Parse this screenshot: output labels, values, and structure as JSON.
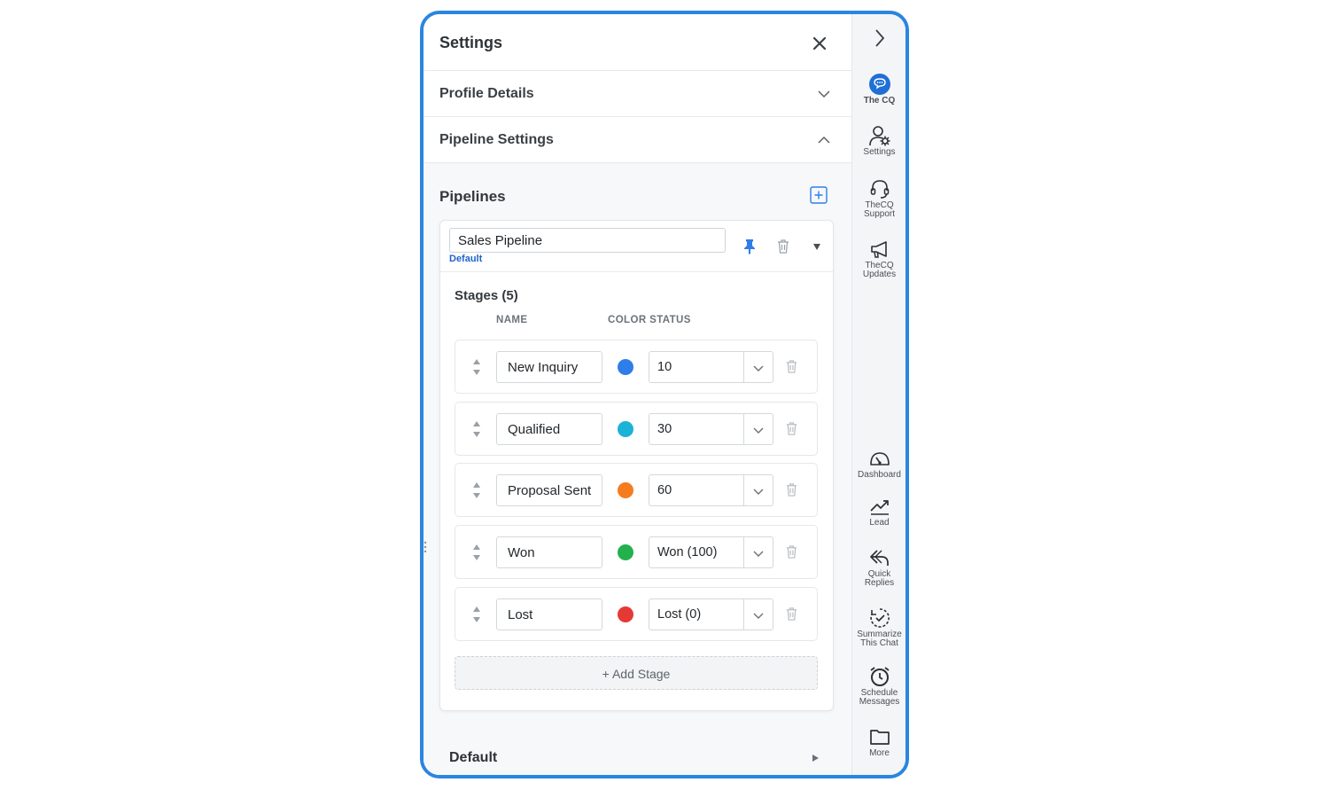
{
  "header": {
    "title": "Settings"
  },
  "accordions": {
    "profile": "Profile Details",
    "pipeline": "Pipeline Settings"
  },
  "pipelines": {
    "title": "Pipelines",
    "pipeline_name": "Sales Pipeline",
    "badge": "Default",
    "stages_title": "Stages (5)",
    "columns": {
      "name": "NAME",
      "color_status": "COLOR STATUS"
    },
    "stages": [
      {
        "name": "New Inquiry",
        "color": "#2f7de8",
        "status": "10"
      },
      {
        "name": "Qualified",
        "color": "#1bb3d6",
        "status": "30"
      },
      {
        "name": "Proposal Sent",
        "color": "#f57c1f",
        "status": "60"
      },
      {
        "name": "Won",
        "color": "#23b14d",
        "status": "Won (100)"
      },
      {
        "name": "Lost",
        "color": "#e53935",
        "status": "Lost (0)"
      }
    ],
    "add_stage": "+ Add Stage",
    "second_pipeline": "Default"
  },
  "rail": {
    "items": [
      {
        "icon": "thecq-chat-icon",
        "label1": "The CQ",
        "label2": ""
      },
      {
        "icon": "user-gear-icon",
        "label1": "Settings",
        "label2": ""
      },
      {
        "icon": "headset-icon",
        "label1": "TheCQ",
        "label2": "Support"
      },
      {
        "icon": "megaphone-icon",
        "label1": "TheCQ",
        "label2": "Updates"
      },
      {
        "icon": "dashboard-gauge-icon",
        "label1": "Dashboard",
        "label2": ""
      },
      {
        "icon": "trend-chart-icon",
        "label1": "Lead",
        "label2": ""
      },
      {
        "icon": "reply-icon",
        "label1": "Quick",
        "label2": "Replies"
      },
      {
        "icon": "summarize-icon",
        "label1": "Summarize",
        "label2": "This Chat"
      },
      {
        "icon": "alarm-clock-icon",
        "label1": "Schedule",
        "label2": "Messages"
      },
      {
        "icon": "folder-icon",
        "label1": "More",
        "label2": ""
      }
    ]
  }
}
